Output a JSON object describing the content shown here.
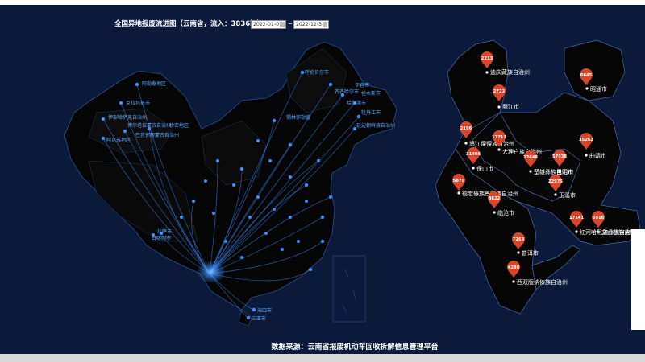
{
  "title": "全国异地报废流进图（云南省，流入：3836辆）",
  "date_start": "2022-01-01",
  "date_end": "2022-12-31",
  "date_separator": "~",
  "footer": "数据来源：云南省报废机动车回收拆解信息管理平台",
  "colors": {
    "background": "#0b1a3b",
    "land": "#050505",
    "flow": "#3a8dff",
    "pin": "#d9452b"
  },
  "icons": {
    "calendar": "calendar-icon",
    "pin": "map-pin-icon"
  },
  "china_cities": [
    "阿勒泰地区",
    "克拉玛依市",
    "伊犁哈萨克自治州",
    "博尔塔拉蒙古自治州",
    "阿克苏地区",
    "巴音郭楞蒙古自治州",
    "哈密地区",
    "呼伦贝尔市",
    "伊春市",
    "齐齐哈尔市",
    "佳木斯市",
    "哈尔滨市",
    "牡丹江市",
    "延边朝鲜族自治州",
    "锡林郭勒盟",
    "海口市",
    "三亚市",
    "拉萨市",
    "日喀则市"
  ],
  "yunnan": {
    "prefectures": [
      {
        "name": "迪庆藏族自治州",
        "value": 2233
      },
      {
        "name": "丽江市",
        "value": 2722
      },
      {
        "name": "怒江傈僳族自治州",
        "value": 2196
      },
      {
        "name": "大理白族自治州",
        "value": 17711
      },
      {
        "name": "保山市",
        "value": 31408
      },
      {
        "name": "楚雄彝族自治州",
        "value": 23648
      },
      {
        "name": "昆明市",
        "value": 57538
      },
      {
        "name": "德宏傣族景颇族自治州",
        "value": 5879
      },
      {
        "name": "临沧市",
        "value": 8622
      },
      {
        "name": "玉溪市",
        "value": 22975
      },
      {
        "name": "昭通市",
        "value": 6645
      },
      {
        "name": "曲靖市",
        "value": 35262
      },
      {
        "name": "红河哈尼族彝族自治州",
        "value": 17141
      },
      {
        "name": "文山壮族苗族自治州",
        "value": 6916
      },
      {
        "name": "普洱市",
        "value": 7268
      },
      {
        "name": "西双版纳傣族自治州",
        "value": 4298
      }
    ]
  }
}
